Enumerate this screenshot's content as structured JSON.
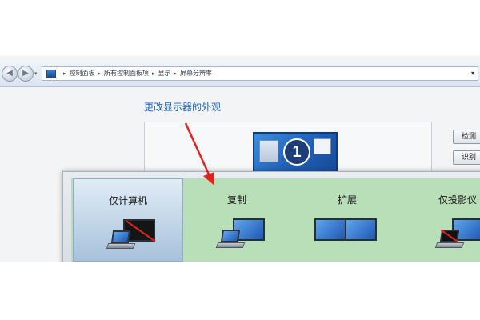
{
  "address_bar": {
    "breadcrumbs": [
      "控制面板",
      "所有控制面板项",
      "显示",
      "屏幕分辨率"
    ],
    "separator": "▸",
    "dropdown_glyph": "▾",
    "back_glyph": "◀",
    "forward_glyph": "▶",
    "nav_dropdown_glyph": "▾"
  },
  "display_settings": {
    "title": "更改显示器的外观",
    "monitor_number": "1",
    "detect_button": "检测",
    "identify_button": "识别"
  },
  "projection_switcher": {
    "options": [
      {
        "label": "仅计算机",
        "selected": true
      },
      {
        "label": "复制",
        "selected": false
      },
      {
        "label": "扩展",
        "selected": false
      },
      {
        "label": "仅投影仪",
        "selected": false
      }
    ]
  },
  "colors": {
    "selected_background": "#a7c2db",
    "options_background": "#b9dfb8",
    "arrow": "#e0231c",
    "link_title": "#1f64b8"
  }
}
